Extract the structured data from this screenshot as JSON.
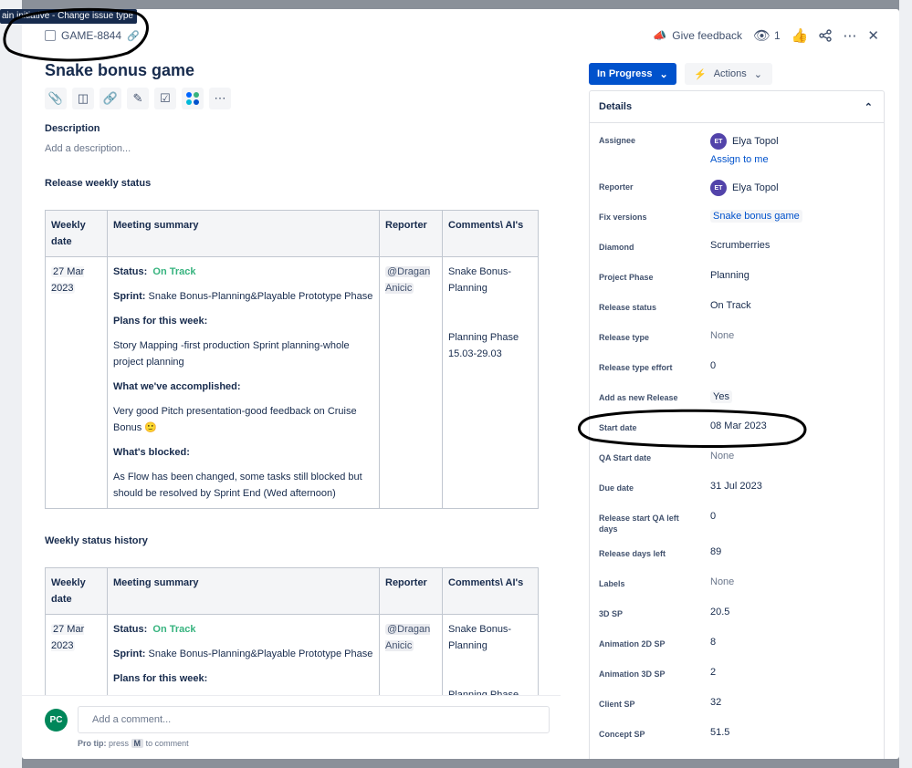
{
  "tooltip": "ain initiative - Change issue type",
  "issue_key": "GAME-8844",
  "header": {
    "feedback_label": "Give feedback",
    "watch_count": "1"
  },
  "title": "Snake bonus game",
  "toolbar": [
    "attachment-icon",
    "child-issue-icon",
    "link-icon",
    "edit-icon",
    "checklist-icon",
    "apps-icon",
    "more-icon"
  ],
  "description": {
    "heading": "Description",
    "placeholder": "Add a description..."
  },
  "release_status": {
    "heading": "Release weekly status",
    "columns": [
      "Weekly date",
      "Meeting summary",
      "Reporter",
      "Comments\\ AI's"
    ],
    "row": {
      "date": "27 Mar 2023",
      "status_label": "Status:",
      "status_value": "On Track",
      "sprint_label": "Sprint:",
      "sprint_value": "Snake Bonus-Planning&Playable Prototype Phase",
      "plans_label": "Plans for this week:",
      "plans_value": "Story Mapping -first production Sprint planning-whole project planning",
      "accomplished_label": "What we've accomplished:",
      "accomplished_value": "Very good Pitch presentation-good feedback on Cruise Bonus",
      "blocked_label": "What's blocked:",
      "blocked_value": "As Flow has been changed, some tasks still blocked but should be resolved by Sprint End (Wed afternoon)",
      "reporter": "@Dragan Anicic",
      "comment1": "Snake Bonus-Planning",
      "comment2": "Planning Phase 15.03-29.03"
    }
  },
  "history": {
    "heading": "Weekly status history",
    "columns": [
      "Weekly date",
      "Meeting summary",
      "Reporter",
      "Comments\\ AI's"
    ],
    "row": {
      "date": "27 Mar 2023",
      "status_label": "Status:",
      "status_value": "On Track",
      "sprint_label": "Sprint:",
      "sprint_value": "Snake Bonus-Planning&Playable Prototype Phase",
      "plans_label": "Plans for this week:",
      "reporter": "@Dragan Anicic",
      "comment1": "Snake Bonus-Planning",
      "comment2": "Planning Phase"
    }
  },
  "comment": {
    "avatar": "PC",
    "placeholder": "Add a comment...",
    "protip_prefix": "Pro tip:",
    "protip_press": "press",
    "protip_key": "M",
    "protip_suffix": "to comment"
  },
  "status_button": "In Progress",
  "actions_button": "Actions",
  "details": {
    "heading": "Details",
    "assignee": {
      "label": "Assignee",
      "initials": "ET",
      "name": "Elya Topol",
      "assign_to_me": "Assign to me"
    },
    "reporter": {
      "label": "Reporter",
      "initials": "ET",
      "name": "Elya Topol"
    },
    "fix_versions": {
      "label": "Fix versions",
      "value": "Snake bonus game"
    },
    "diamond": {
      "label": "Diamond",
      "value": "Scrumberries"
    },
    "project_phase": {
      "label": "Project Phase",
      "value": "Planning"
    },
    "release_status": {
      "label": "Release status",
      "value": "On Track"
    },
    "release_type": {
      "label": "Release type",
      "value": "None"
    },
    "release_type_effort": {
      "label": "Release type effort",
      "value": "0"
    },
    "add_as_new_release": {
      "label": "Add as new Release",
      "value": "Yes"
    },
    "start_date": {
      "label": "Start date",
      "value": "08 Mar 2023"
    },
    "qa_start_date": {
      "label": "QA Start date",
      "value": "None"
    },
    "due_date": {
      "label": "Due date",
      "value": "31 Jul 2023"
    },
    "release_start_qa_left": {
      "label": "Release start QA left days",
      "value": "0"
    },
    "release_days_left": {
      "label": "Release days left",
      "value": "89"
    },
    "labels": {
      "label": "Labels",
      "value": "None"
    },
    "sp_3d": {
      "label": "3D SP",
      "value": "20.5"
    },
    "animation_2d_sp": {
      "label": "Animation 2D SP",
      "value": "8"
    },
    "animation_3d_sp": {
      "label": "Animation 3D SP",
      "value": "2"
    },
    "client_sp": {
      "label": "Client SP",
      "value": "32"
    },
    "concept_sp": {
      "label": "Concept SP",
      "value": "51.5"
    }
  }
}
